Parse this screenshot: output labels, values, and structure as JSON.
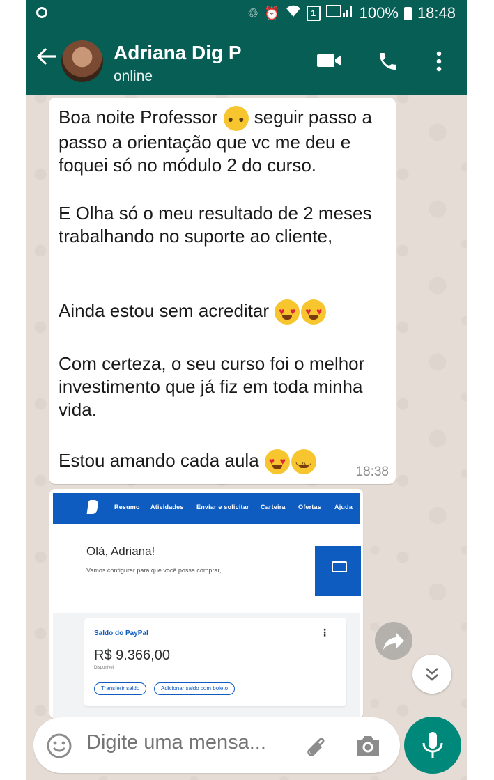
{
  "status_bar": {
    "battery": "100%",
    "time": "18:48",
    "sim_label": "1",
    "icons": [
      "whatsapp-notification-icon",
      "clean-icon",
      "alarm-icon",
      "wifi-icon",
      "sim-icon",
      "signal-icon",
      "battery-icon"
    ]
  },
  "header": {
    "contact_name": "Adriana Dig P",
    "status": "online",
    "icons": [
      "back-arrow-icon",
      "video-call-icon",
      "phone-call-icon",
      "more-vert-icon"
    ]
  },
  "message": {
    "paragraphs": [
      {
        "before": "Boa noite Professor ",
        "emoji": "pleading-face",
        "after": " seguir passo a passo a orientação que vc me deu e foquei só no módulo 2 do curso."
      },
      {
        "text": "E Olha só o meu resultado de 2 meses trabalhando no suporte ao cliente,"
      },
      {
        "text": "Ainda estou sem acreditar",
        "emojis": [
          "heart-eyes",
          "heart-eyes"
        ]
      },
      {
        "text": "Com certeza, o seu curso foi o melhor investimento que já fiz em toda minha vida."
      },
      {
        "text": "Estou amando cada aula",
        "emojis": [
          "heart-eyes",
          "smiling-face-with-hearts"
        ]
      }
    ],
    "time": "18:38"
  },
  "paypal_screenshot": {
    "nav_tabs": [
      "Resumo",
      "Atividades",
      "Enviar e solicitar",
      "Carteira",
      "Ofertas",
      "Ajuda"
    ],
    "greeting": "Olá, Adriana!",
    "subtitle": "Vamos configurar para que você possa comprar,",
    "balance_title": "Saldo do PayPal",
    "balance": "R$ 9.366,00",
    "available": "Disponível",
    "buttons": [
      "Transferir saldo",
      "Adicionar saldo com boleto"
    ]
  },
  "input": {
    "placeholder": "Digite uma mensa...",
    "icons": [
      "emoji-icon",
      "attach-icon",
      "camera-icon",
      "mic-icon"
    ]
  },
  "colors": {
    "header": "#075e54",
    "chat_bg": "#e5ddd5",
    "paypal_blue": "#0f5cc0",
    "mic_button": "#00897b"
  }
}
